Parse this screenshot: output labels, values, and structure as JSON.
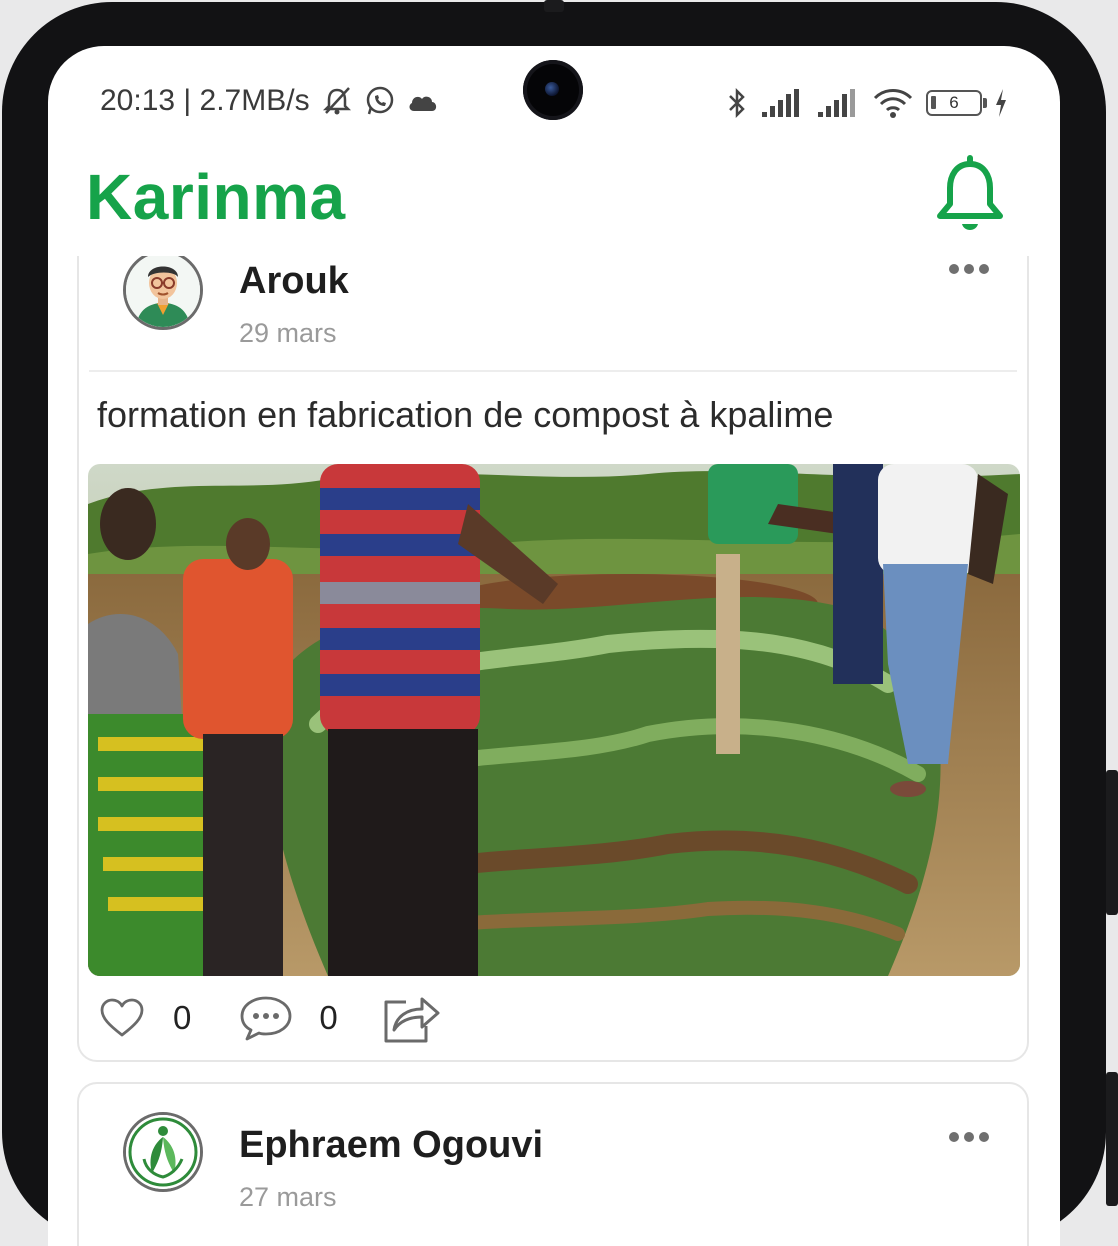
{
  "status_bar": {
    "time_speed": "20:13 | 2.7MB/s",
    "battery_level": "6",
    "left_icons": [
      "mute-icon",
      "whatsapp-icon",
      "cloud-icon"
    ],
    "right_icons": [
      "bluetooth-icon",
      "signal-icon",
      "signal-icon",
      "wifi-icon",
      "battery-icon",
      "charging-icon"
    ]
  },
  "header": {
    "brand": "Karinma",
    "brand_color": "#16a34a",
    "notification_icon": "bell-icon"
  },
  "feed": {
    "posts": [
      {
        "author": "Arouk",
        "date": "29 mars",
        "text": "formation en fabrication de compost à kpalime",
        "avatar_icon": "cartoon-avatar",
        "photo": "compost-training-photo",
        "likes": "0",
        "comments": "0",
        "share_icon": "share-icon"
      },
      {
        "author": "Ephraem Ogouvi",
        "date": "27 mars",
        "avatar_icon": "leaf-logo-avatar"
      }
    ]
  }
}
